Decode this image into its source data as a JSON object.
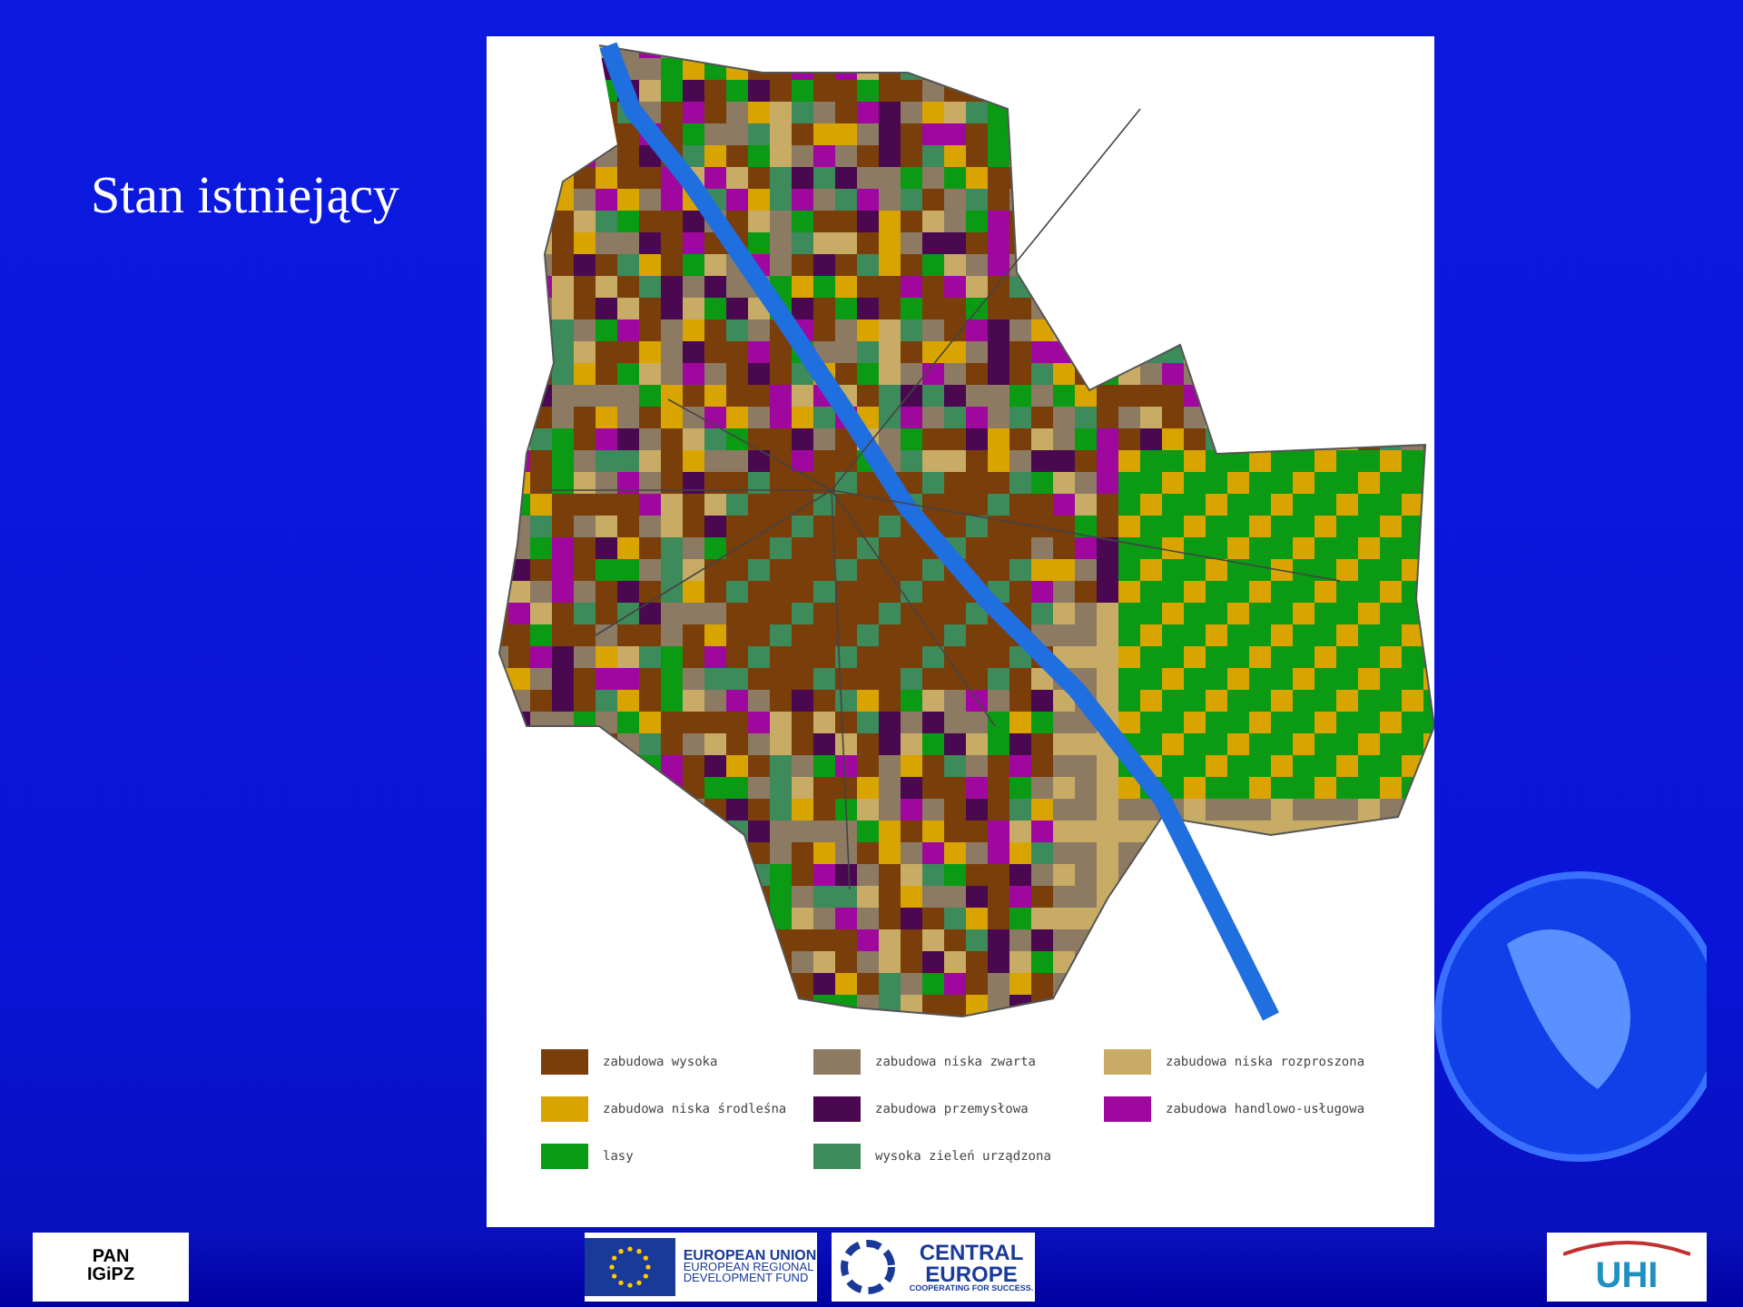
{
  "title": "Stan istniejący",
  "legend": [
    {
      "label": "zabudowa wysoka",
      "color": "#7a3e0a"
    },
    {
      "label": "zabudowa niska zwarta",
      "color": "#8c7a62"
    },
    {
      "label": "zabudowa niska rozproszona",
      "color": "#c8ac66"
    },
    {
      "label": "zabudowa niska środleśna",
      "color": "#d9a400"
    },
    {
      "label": "zabudowa przemysłowa",
      "color": "#4a0850"
    },
    {
      "label": "zabudowa handlowo-usługowa",
      "color": "#a0079e"
    },
    {
      "label": "lasy",
      "color": "#0a9a14"
    },
    {
      "label": "wysoka zieleń urządzona",
      "color": "#3d8a5a"
    }
  ],
  "footer": {
    "institute_logo": [
      "PAN",
      "IGiPZ"
    ],
    "eu_logo": [
      "EUROPEAN UNION",
      "EUROPEAN REGIONAL",
      "DEVELOPMENT FUND"
    ],
    "programme_logo": [
      "CENTRAL",
      "EUROPE",
      "COOPERATING FOR SUCCESS."
    ],
    "project_logo": "UHI"
  }
}
